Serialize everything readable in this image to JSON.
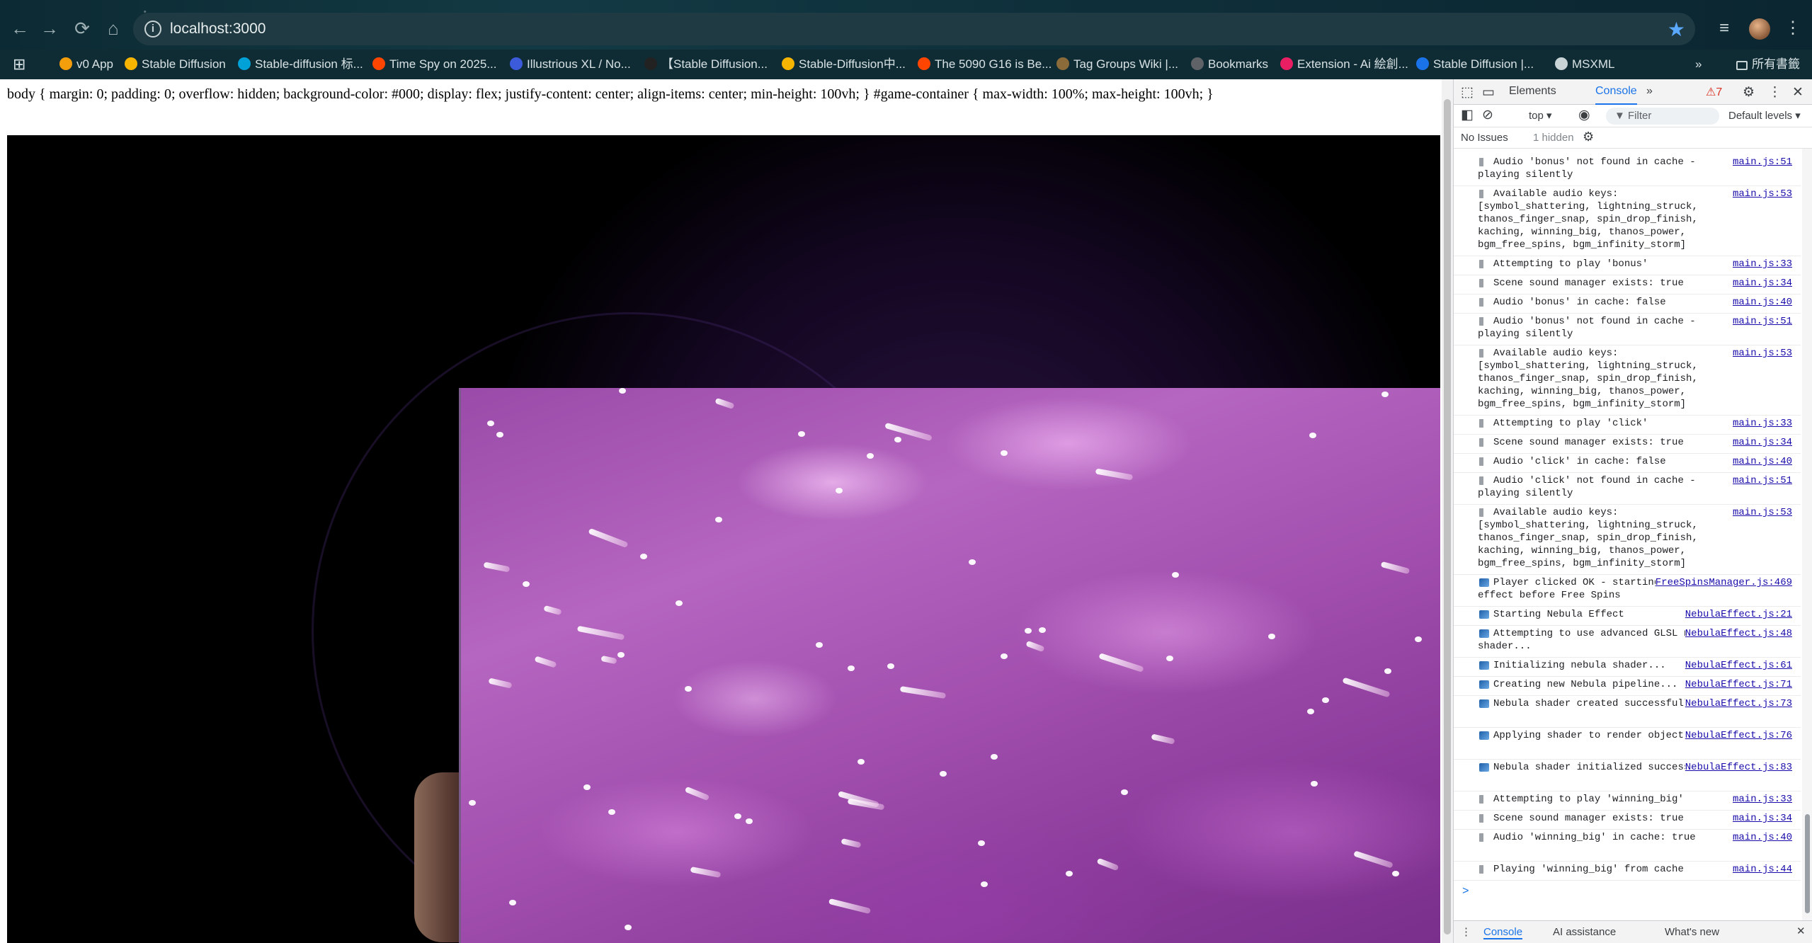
{
  "browser": {
    "url": "localhost:3000",
    "bookmarks": [
      {
        "label": "v0 App",
        "color": "#f59e0b"
      },
      {
        "label": "Stable Diffusion",
        "color": "#f5b400"
      },
      {
        "label": "Stable-diffusion 标...",
        "color": "#00a1d6"
      },
      {
        "label": "Time Spy on 2025...",
        "color": "#ff4500"
      },
      {
        "label": "Illustrious XL / No...",
        "color": "#3b5bdb"
      },
      {
        "label": "【Stable Diffusion...",
        "color": "#222222"
      },
      {
        "label": "Stable-Diffusion中...",
        "color": "#f5b400"
      },
      {
        "label": "The 5090 G16 is Be...",
        "color": "#ff4500"
      },
      {
        "label": "Tag Groups Wiki |...",
        "color": "#8b6b3a"
      },
      {
        "label": "Bookmarks",
        "color": "#5f6368"
      },
      {
        "label": "Extension - Ai 絵創...",
        "color": "#e91e63"
      },
      {
        "label": "Stable Diffusion |...",
        "color": "#1a73e8"
      },
      {
        "label": "MSXML",
        "color": "#c9d4d6"
      }
    ],
    "all_bookmarks": "所有書籤",
    "overflow": "»"
  },
  "page": {
    "css_text": "body { margin: 0; padding: 0; overflow: hidden; background-color: #000; display: flex; justify-content: center; align-items: center; min-height: 100vh; } #game-container { max-width: 100%; max-height: 100vh; }"
  },
  "devtools": {
    "tabs": {
      "elements": "Elements",
      "console": "Console",
      "more": "»"
    },
    "warnings": "7",
    "context": "top",
    "filter_placeholder": "Filter",
    "levels": "Default levels",
    "issues": "No Issues",
    "hidden": "1 hidden",
    "logs": [
      {
        "icon": "snd",
        "text": "Audio 'bonus' not found in cache - playing silently",
        "src": "main.js:51"
      },
      {
        "icon": "snd",
        "text": "Available audio keys: [symbol_shattering, lightning_struck, thanos_finger_snap, spin_drop_finish, kaching, winning_big, thanos_power, bgm_free_spins, bgm_infinity_storm]",
        "src": "main.js:53"
      },
      {
        "icon": "snd",
        "text": "Attempting to play 'bonus'",
        "src": "main.js:33"
      },
      {
        "icon": "snd",
        "text": "Scene sound manager exists: true",
        "src": "main.js:34"
      },
      {
        "icon": "snd",
        "text": "Audio 'bonus' in cache: false",
        "src": "main.js:40"
      },
      {
        "icon": "snd",
        "text": "Audio 'bonus' not found in cache - playing silently",
        "src": "main.js:51"
      },
      {
        "icon": "snd",
        "text": "Available audio keys: [symbol_shattering, lightning_struck, thanos_finger_snap, spin_drop_finish, kaching, winning_big, thanos_power, bgm_free_spins, bgm_infinity_storm]",
        "src": "main.js:53"
      },
      {
        "icon": "snd",
        "text": "Attempting to play 'click'",
        "src": "main.js:33"
      },
      {
        "icon": "snd",
        "text": "Scene sound manager exists: true",
        "src": "main.js:34"
      },
      {
        "icon": "snd",
        "text": "Audio 'click' in cache: false",
        "src": "main.js:40"
      },
      {
        "icon": "snd",
        "text": "Audio 'click' not found in cache - playing silently",
        "src": "main.js:51"
      },
      {
        "icon": "snd",
        "text": "Available audio keys: [symbol_shattering, lightning_struck, thanos_finger_snap, spin_drop_finish, kaching, winning_big, thanos_power, bgm_free_spins, bgm_infinity_storm]",
        "src": "main.js:53"
      },
      {
        "icon": "img",
        "text": "Player clicked OK - starting nebula effect before Free Spins",
        "src": "FreeSpinsManager.js:469"
      },
      {
        "icon": "img",
        "text": "Starting Nebula Effect",
        "src": "NebulaEffect.js:21"
      },
      {
        "icon": "img",
        "text": "Attempting to use advanced GLSL nebula shader...",
        "src": "NebulaEffect.js:48"
      },
      {
        "icon": "img",
        "text": "Initializing nebula shader...",
        "src": "NebulaEffect.js:61"
      },
      {
        "icon": "img",
        "text": "Creating new Nebula pipeline...",
        "src": "NebulaEffect.js:71"
      },
      {
        "icon": "img",
        "text": "Nebula shader created successfully",
        "src": "NebulaEffect.js:73"
      },
      {
        "icon": "img",
        "text": "Applying shader to render object...",
        "src": "NebulaEffect.js:76"
      },
      {
        "icon": "img",
        "text": "Nebula shader initialized successfully",
        "src": "NebulaEffect.js:83"
      },
      {
        "icon": "snd",
        "text": "Attempting to play 'winning_big'",
        "src": "main.js:33"
      },
      {
        "icon": "snd",
        "text": "Scene sound manager exists: true",
        "src": "main.js:34"
      },
      {
        "icon": "snd",
        "text": "Audio 'winning_big' in cache: true",
        "src": "main.js:40"
      },
      {
        "icon": "snd",
        "text": "Playing 'winning_big' from cache",
        "src": "main.js:44"
      }
    ],
    "prompt": ">",
    "drawer_tabs": {
      "console": "Console",
      "ai": "AI assistance",
      "whats_new": "What's new"
    }
  }
}
